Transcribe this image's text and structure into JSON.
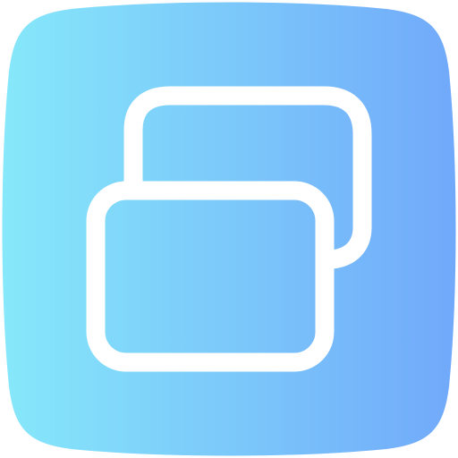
{
  "icon": {
    "name": "windows-stack-icon",
    "gradient_start": "#86E8FA",
    "gradient_end": "#71A9FA",
    "stroke_color": "#FFFFFF"
  }
}
